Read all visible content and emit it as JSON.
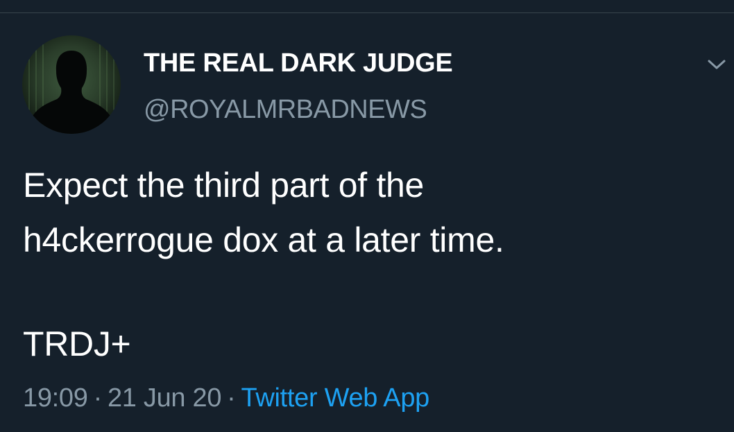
{
  "tweet": {
    "display_name": "THE REAL DARK JUDGE",
    "handle": "@ROYALMRBADNEWS",
    "text_line_1": "Expect the third part of the",
    "text_line_2": "h4ckerrogue dox at a later time.",
    "signature": "TRDJ+",
    "time": "19:09",
    "separator": "·",
    "date": "21 Jun 20",
    "source": "Twitter Web App"
  },
  "icons": {
    "caret": "chevron-down-icon",
    "avatar": "silhouette-avatar"
  },
  "colors": {
    "background": "#15202b",
    "primary_text": "#ffffff",
    "secondary_text": "#8899a6",
    "link": "#1da1f2",
    "divider": "#38444d"
  }
}
